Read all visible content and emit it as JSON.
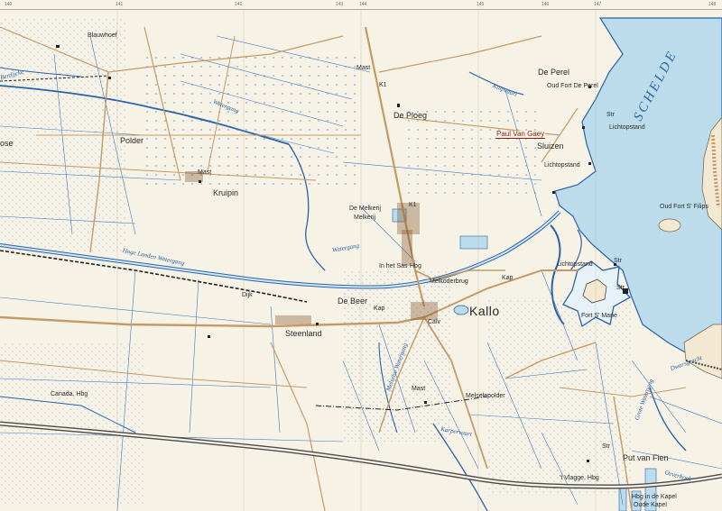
{
  "map": {
    "topbar": {
      "ticks": [
        "140",
        "141",
        "142",
        "143",
        "144",
        "145",
        "146",
        "147",
        "148"
      ]
    },
    "labels": {
      "blauwhoef": "Blauwhoef",
      "mast1": "Mast",
      "de_perel": "De Perel",
      "oud_fort_de_perel": "Oud Fort De Perel",
      "de_ploeg": "De Ploeg",
      "ose": "ose",
      "polder": "Polder",
      "lichtopstand1": "Lichtopstand",
      "restaurant": "Paul Van Gaey",
      "sluizen": "Sluizen",
      "lichtopstand2": "Lichtopstand",
      "mast2": "Mast",
      "kruipin": "Kruipin",
      "de_melkerij": "De Melkerij",
      "melkerij": "Melkerij",
      "oud_fort_st_filips": "Oud Fort S' Filips",
      "in_het_sas": "In het Sas",
      "hbg1": "Hbg",
      "melkoderbrug": "Melkoderbrug",
      "kap1": "Kap",
      "lichtopstand3": "Lichtopstand",
      "str1": "Str",
      "str2": "Str",
      "str3": "Str",
      "dijk": "Dijk",
      "de_beer": "De Beer",
      "kap2": "Kap",
      "kallo": "Kallo",
      "fort_st_marie": "Fort S' Marie",
      "calv": "Calv",
      "steenland": "Steenland",
      "canada_hbg": "Canada, Hbg",
      "mast3": "Mast",
      "melselepolder": "Melselepolder",
      "put_van_fien": "Put van Fien",
      "t_vlaggen_hbg": "'t Vlagge, Hbg",
      "hbg_in_de_kapel": "Hbg in de Kapel",
      "oude_kapel": "Oude Kapel",
      "k1": "K1",
      "k2": "K1",
      "str4": "Str"
    },
    "water_labels": {
      "schelde": "SCHELDE",
      "watergang1": "Watergang",
      "hoge_landen_watergang": "Hoge Landen Watergang",
      "watergang2": "Watergang",
      "kuipvaart": "Kuipvaart",
      "melselse_watergang": "Melselse Watergang",
      "karpervaart": "Karpervaart",
      "dwarsgracht": "Dwarsgracht",
      "oeverhoek": "Oeverhoek",
      "grote_watergang": "Grote Watergang",
      "berdijcke": "Berdijcke"
    }
  }
}
